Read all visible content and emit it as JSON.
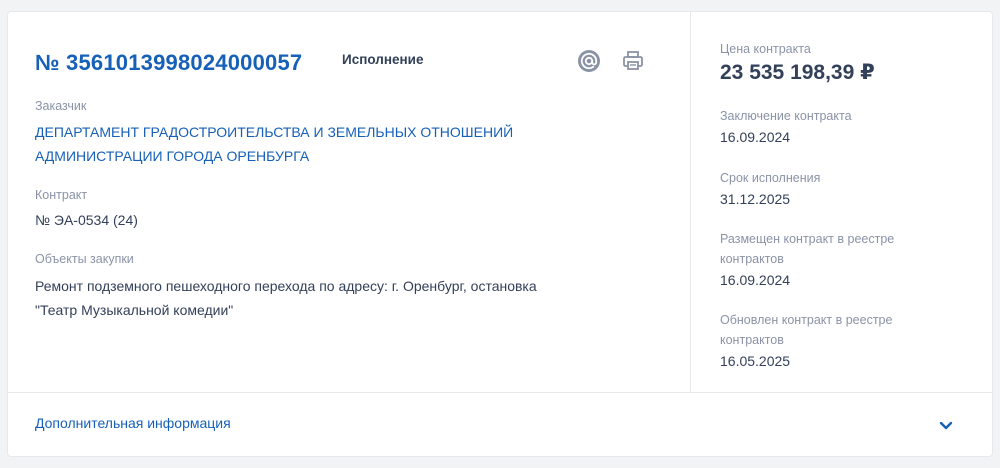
{
  "contract": {
    "reg_number": "№ 3561013998024000057",
    "status": "Исполнение",
    "customer_label": "Заказчик",
    "customer_line1": "ДЕПАРТАМЕНТ ГРАДОСТРОИТЕЛЬСТВА И ЗЕМЕЛЬНЫХ ОТНОШЕНИЙ",
    "customer_line2": "АДМИНИСТРАЦИИ ГОРОДА ОРЕНБУРГА",
    "contract_label": "Контракт",
    "contract_value": "№ ЭА-0534 (24)",
    "objects_label": "Объекты закупки",
    "objects_line1": "Ремонт подземного пешеходного перехода по адресу: г. Оренбург, остановка",
    "objects_line2": "\"Театр Музыкальной комедии\""
  },
  "side": {
    "price_label": "Цена контракта",
    "price_value": "23 535 198,39 ₽",
    "conclusion_label": "Заключение контракта",
    "conclusion_value": "16.09.2024",
    "term_label": "Срок исполнения",
    "term_value": "31.12.2025",
    "placed_label_line1": "Размещен контракт в реестре",
    "placed_label_line2": "контрактов",
    "placed_value": "16.09.2024",
    "updated_label_line1": "Обновлен контракт в реестре",
    "updated_label_line2": "контрактов",
    "updated_value": "16.05.2025"
  },
  "footer": {
    "more_info": "Дополнительная информация"
  },
  "icons": {
    "email": "email-at-icon",
    "print": "printer-icon",
    "expand": "chevron-down-icon"
  },
  "colors": {
    "link": "#1660b8",
    "text": "#334059",
    "muted": "#8a93a6",
    "border": "#e6e8ec"
  }
}
